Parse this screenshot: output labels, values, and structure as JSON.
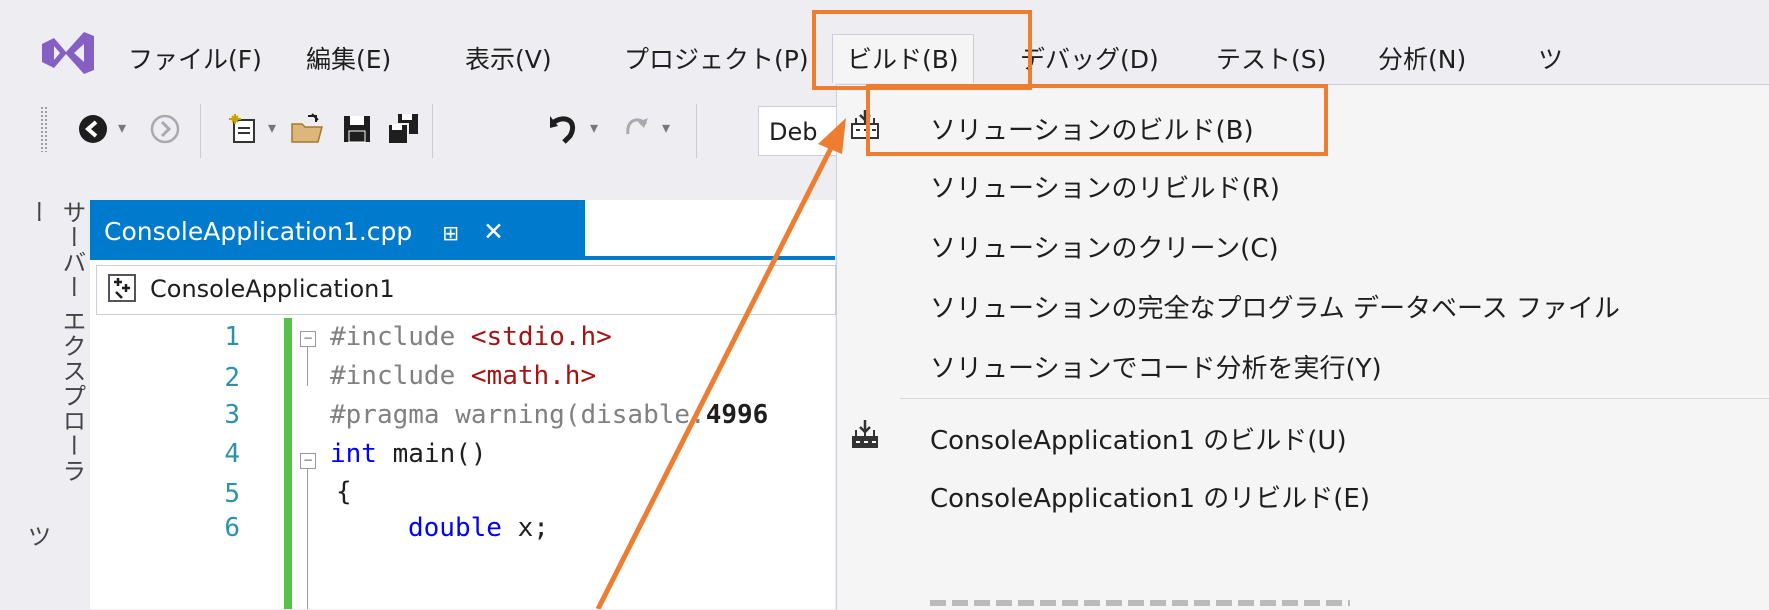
{
  "menubar": {
    "items": [
      "ファイル(F)",
      "編集(E)",
      "表示(V)",
      "プロジェクト(P)",
      "ビルド(B)",
      "デバッグ(D)",
      "テスト(S)",
      "分析(N)",
      "ツ"
    ]
  },
  "toolbar": {
    "config_value": "Deb"
  },
  "left_tabs": {
    "server_explorer": "サーバー エクスプローラー",
    "toolbox": "ツ"
  },
  "editor": {
    "tab_title": "ConsoleApplication1.cpp",
    "tab_pin": "⊞",
    "tab_close": "✕",
    "nav_scope": "ConsoleApplication1",
    "line_numbers": [
      "1",
      "2",
      "3",
      "4",
      "5",
      "6"
    ],
    "code": {
      "l1_pp": "#include ",
      "l1_str": "<stdio.h>",
      "l2_pp": "#include ",
      "l2_str": "<math.h>",
      "l3_pp": "#pragma warning(disable:",
      "l3_num": "4996",
      "l4_kw": "int",
      "l4_rest": " main()",
      "l5": "{",
      "l6_kw": "double",
      "l6_rest": " x;"
    }
  },
  "build_menu": {
    "items": [
      "ソリューションのビルド(B)",
      "ソリューションのリビルド(R)",
      "ソリューションのクリーン(C)",
      "ソリューションの完全なプログラム データベース ファイル",
      "ソリューションでコード分析を実行(Y)",
      "ConsoleApplication1 のビルド(U)",
      "ConsoleApplication1 のリビルド(E)"
    ]
  },
  "colors": {
    "accent": "#007acc",
    "annotation": "#ed7d31",
    "highlight": "#c9def5",
    "change_bar": "#57c14a"
  }
}
